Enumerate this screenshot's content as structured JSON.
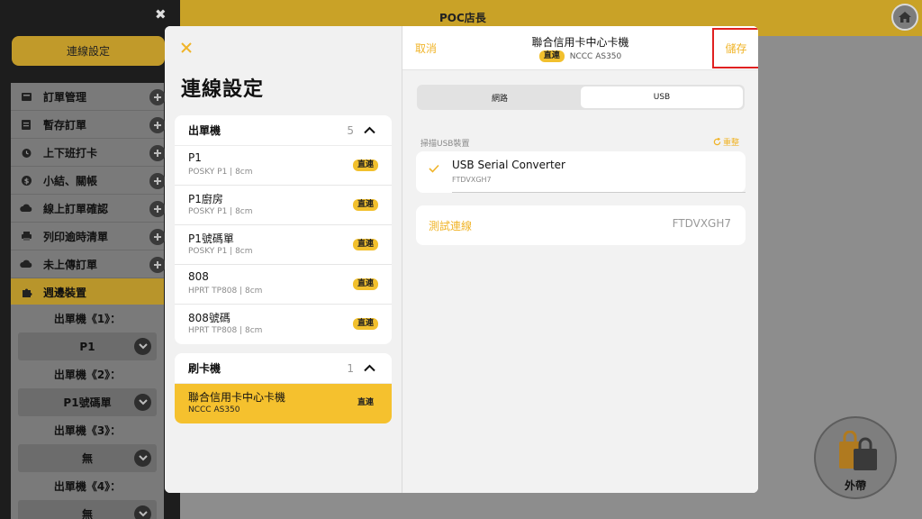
{
  "header": {
    "title": "POC店長"
  },
  "sidebar": {
    "connection_button": "連線設定",
    "items": [
      {
        "label": "訂單管理",
        "icon": "order-icon"
      },
      {
        "label": "暫存訂單",
        "icon": "hold-order-icon"
      },
      {
        "label": "上下班打卡",
        "icon": "clock-icon"
      },
      {
        "label": "小結、關帳",
        "icon": "dollar-icon"
      },
      {
        "label": "線上訂單確認",
        "icon": "cloud-download-icon"
      },
      {
        "label": "列印逾時清單",
        "icon": "printer-icon"
      },
      {
        "label": "未上傳訂單",
        "icon": "cloud-upload-icon"
      },
      {
        "label": "週邊裝置",
        "icon": "puzzle-icon"
      }
    ],
    "devices": [
      {
        "label": "出單機《1》：",
        "value": "P1"
      },
      {
        "label": "出單機《2》：",
        "value": "P1號碼單"
      },
      {
        "label": "出單機《3》：",
        "value": "無"
      },
      {
        "label": "出單機《4》：",
        "value": "無"
      }
    ]
  },
  "takeout": {
    "label": "外帶"
  },
  "modal": {
    "title": "連線設定",
    "printers": {
      "title": "出單機",
      "count": "5",
      "items": [
        {
          "name": "P1",
          "sub": "POSKY P1 | 8cm",
          "badge": "直連"
        },
        {
          "name": "P1廚房",
          "sub": "POSKY P1 | 8cm",
          "badge": "直連"
        },
        {
          "name": "P1號碼單",
          "sub": "POSKY P1 | 8cm",
          "badge": "直連"
        },
        {
          "name": "808",
          "sub": "HPRT TP808 | 8cm",
          "badge": "直連"
        },
        {
          "name": "808號碼",
          "sub": "HPRT TP808 | 8cm",
          "badge": "直連"
        }
      ]
    },
    "card_readers": {
      "title": "刷卡機",
      "count": "1",
      "items": [
        {
          "name": "聯合信用卡中心卡機",
          "sub": "NCCC AS350",
          "badge": "直連"
        }
      ]
    },
    "detail": {
      "cancel": "取消",
      "title": "聯合信用卡中心卡機",
      "badge": "直連",
      "subtitle": "NCCC AS350",
      "save": "儲存",
      "tabs": [
        "網路",
        "USB"
      ],
      "active_tab": "USB",
      "scan_label": "掃描USB裝置",
      "reset": "重整",
      "usb_device": {
        "name": "USB Serial Converter",
        "serial": "FTDVXGH7"
      },
      "test_label": "測試連線",
      "test_value": "FTDVXGH7"
    }
  },
  "colors": {
    "accent": "#f0b429",
    "badge": "#f2c02d",
    "highlight_border": "#e02020"
  }
}
